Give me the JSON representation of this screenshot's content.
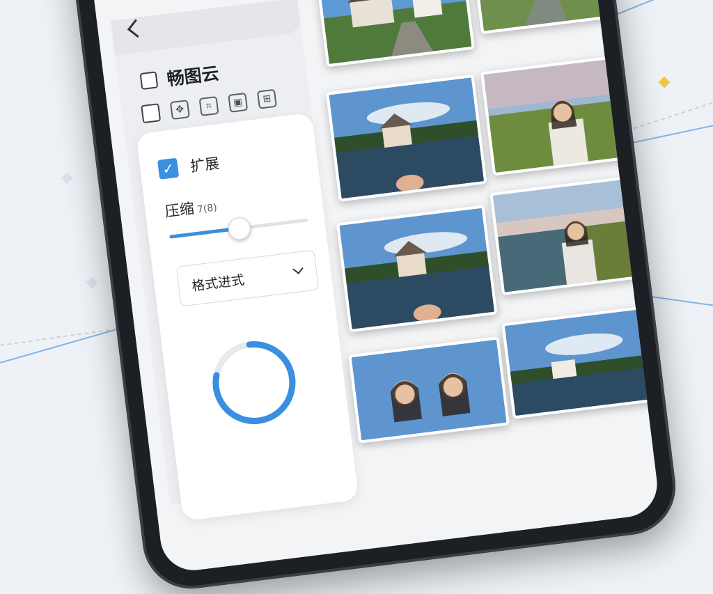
{
  "app": {
    "title": "畅图云"
  },
  "toolbar": {
    "icons": [
      "image-adjust-icon",
      "crop-icon",
      "frame-icon",
      "grid-icon"
    ]
  },
  "settings": {
    "checkbox_label": "扩展",
    "checkbox_checked": true,
    "compress_label": "压缩",
    "compress_value": "7",
    "compress_value_glyph": "(8)",
    "compress_fraction": 0.5,
    "format_select": "格式进式",
    "progress_fraction": 0.8
  },
  "colors": {
    "accent": "#3a8fe0"
  },
  "photos": [
    {
      "scene": "house-road"
    },
    {
      "scene": "field-path"
    },
    {
      "scene": "lake-house"
    },
    {
      "scene": "woman-field"
    },
    {
      "scene": "lake-house"
    },
    {
      "scene": "woman-lake"
    },
    {
      "scene": "two-women"
    },
    {
      "scene": "lake-house"
    }
  ]
}
